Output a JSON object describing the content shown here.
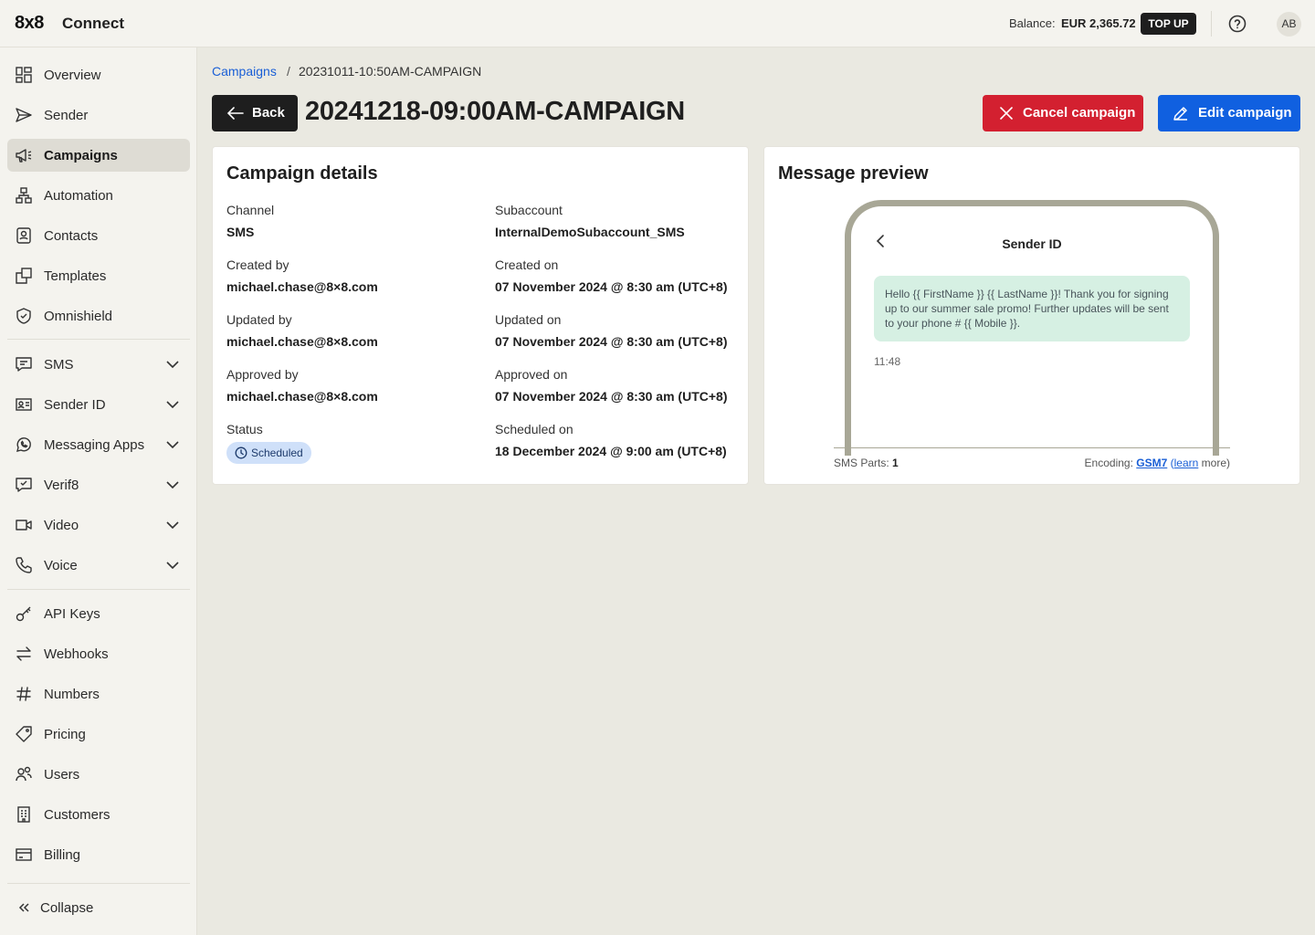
{
  "header": {
    "logo": "8x8",
    "app_name": "Connect",
    "balance_label": "Balance:",
    "balance_amount": "EUR 2,365.72",
    "topup_label": "TOP UP",
    "avatar_initials": "AB"
  },
  "sidebar": {
    "items": [
      {
        "label": "Overview",
        "icon": "overview-icon"
      },
      {
        "label": "Sender",
        "icon": "send-icon"
      },
      {
        "label": "Campaigns",
        "icon": "megaphone-icon",
        "active": true
      },
      {
        "label": "Automation",
        "icon": "automation-icon"
      },
      {
        "label": "Contacts",
        "icon": "contacts-icon"
      },
      {
        "label": "Templates",
        "icon": "templates-icon"
      },
      {
        "label": "Omnishield",
        "icon": "shield-icon"
      },
      {
        "label": "SMS",
        "icon": "chat-icon",
        "expandable": true
      },
      {
        "label": "Sender ID",
        "icon": "id-card-icon",
        "expandable": true
      },
      {
        "label": "Messaging Apps",
        "icon": "whatsapp-icon",
        "expandable": true
      },
      {
        "label": "Verif8",
        "icon": "verify-icon",
        "expandable": true
      },
      {
        "label": "Video",
        "icon": "video-icon",
        "expandable": true
      },
      {
        "label": "Voice",
        "icon": "phone-icon",
        "expandable": true
      },
      {
        "label": "API Keys",
        "icon": "key-icon"
      },
      {
        "label": "Webhooks",
        "icon": "webhooks-icon"
      },
      {
        "label": "Numbers",
        "icon": "hash-icon"
      },
      {
        "label": "Pricing",
        "icon": "tag-icon"
      },
      {
        "label": "Users",
        "icon": "users-icon"
      },
      {
        "label": "Customers",
        "icon": "building-icon"
      },
      {
        "label": "Billing",
        "icon": "credit-card-icon"
      }
    ],
    "collapse_label": "Collapse"
  },
  "breadcrumb": {
    "parent": "Campaigns",
    "separator": "/",
    "current": "20231011-10:50AM-CAMPAIGN"
  },
  "toolbar": {
    "back_label": "Back",
    "cancel_label": "Cancel campaign",
    "edit_label": "Edit campaign"
  },
  "page_title": "20241218-09:00AM-CAMPAIGN",
  "details": {
    "title": "Campaign details",
    "channel_label": "Channel",
    "channel_value": "SMS",
    "subaccount_label": "Subaccount",
    "subaccount_value": "InternalDemoSubaccount_SMS",
    "created_by_label": "Created by",
    "created_by_value": "michael.chase@8×8.com",
    "created_on_label": "Created on",
    "created_on_value": "07 November 2024 @ 8:30 am (UTC+8)",
    "updated_by_label": "Updated by",
    "updated_by_value": "michael.chase@8×8.com",
    "updated_on_label": "Updated on",
    "updated_on_value": "07 November 2024 @ 8:30 am (UTC+8)",
    "approved_by_label": "Approved by",
    "approved_by_value": "michael.chase@8×8.com",
    "approved_on_label": "Approved on",
    "approved_on_value": "07 November 2024 @ 8:30 am (UTC+8)",
    "status_label": "Status",
    "status_value": "Scheduled",
    "scheduled_on_label": "Scheduled on",
    "scheduled_on_value": "18 December 2024 @ 9:00 am (UTC+8)"
  },
  "preview": {
    "title": "Message preview",
    "sender_id": "Sender ID",
    "message": "Hello {{ FirstName }} {{ LastName }}! Thank you for signing up to our summer sale promo! Further updates will be sent to your phone # {{ Mobile }}.",
    "time": "11:48",
    "sms_parts_label": "SMS Parts:",
    "sms_parts_value": "1",
    "encoding_label": "Encoding:",
    "encoding_value": "GSM7",
    "learn_label": "learn",
    "more_label": "more)"
  },
  "colors": {
    "accent_blue": "#1060e0",
    "danger_red": "#d32030",
    "bubble_green": "#d6f0e3",
    "badge_blue": "#cfe0f9"
  }
}
